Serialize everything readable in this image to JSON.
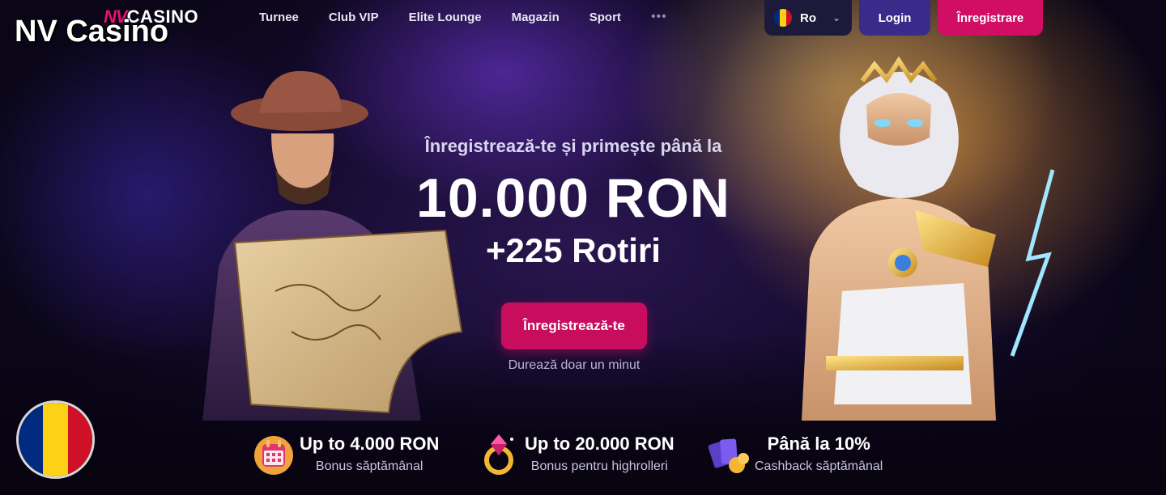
{
  "overlay_title": "NV Casino",
  "logo": {
    "mark": "NV",
    "word": "CASINO"
  },
  "nav": {
    "items": [
      "Turnee",
      "Club VIP",
      "Elite Lounge",
      "Magazin",
      "Sport"
    ],
    "more": "•••"
  },
  "language": {
    "code": "Ro",
    "flag_colors": [
      "#002B7F",
      "#FCD116",
      "#CE1126"
    ]
  },
  "header_buttons": {
    "login": "Login",
    "register": "Înregistrare"
  },
  "hero": {
    "subtitle": "Înregistrează-te și primește până la",
    "amount": "10.000 RON",
    "spins": "+225 Rotiri",
    "cta": "Înregistrează-te",
    "note": "Durează doar un minut"
  },
  "features": [
    {
      "icon": "calendar-gift-icon",
      "title": "Up to 4.000 RON",
      "subtitle": "Bonus săptămânal"
    },
    {
      "icon": "diamond-ring-icon",
      "title": "Up to 20.000 RON",
      "subtitle": "Bonus pentru highrolleri"
    },
    {
      "icon": "cards-coins-icon",
      "title": "Până la 10%",
      "subtitle": "Cashback săptămânal"
    }
  ],
  "colors": {
    "accent": "#D10E63",
    "login": "#3A2A8A",
    "lang_bg": "#1C1A3A"
  }
}
